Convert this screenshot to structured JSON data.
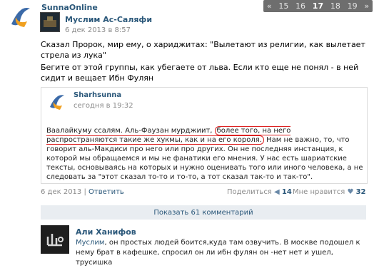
{
  "group": {
    "name": "SunnaOnline"
  },
  "pager": {
    "pages": [
      "«",
      "15",
      "16",
      "17",
      "18",
      "19",
      "»"
    ],
    "current": "17"
  },
  "post": {
    "author": "Муслим Ас-Саляфи",
    "date": "6 дек 2013 в 8:57",
    "paragraph1": "Сказал Пророк, мир ему, о хариджитах: \"Вылетают из религии, как вылетает стрела из лука\"",
    "paragraph2": "Бегите от этой группы, как убегаете от льва. Если кто еще не понял - в ней сидит и вещает Ибн Фулян"
  },
  "quote": {
    "author": "Sharhsunna",
    "date": "сегодня в 19:32",
    "text_before": "Ваалайкуму ссалям. Аль-Фаузан мурджиит, ",
    "text_highlight": "более того, на него распространяются такие же хукмы, как и на его короля.",
    "text_after": " Нам не важно, то, что говорит аль-Макдиси про него или про других. Он не последняя инстанция, к которой мы обращаемся и мы не фанатики его мнения. У нас есть шариатские тексты, основываясь на которых и нужно оценивать того или иного человека, а не следовать за \"этот сказал то-то и то-то, а тот сказал так-то и так-то\"."
  },
  "footer": {
    "date": "6 дек 2013",
    "separator": " | ",
    "reply": "Ответить",
    "share_label": "Поделиться",
    "share_count": "14",
    "like_label": "Мне нравится",
    "like_count": "32"
  },
  "comments_button": "Показать 61 комментарий",
  "comment": {
    "author": "Али Ханифов",
    "mention": "Муслим",
    "text": ", он простых людей боится,куда там озвучить. В москве подошел к нему брат в кафешке, спросил он ли ибн фулян он -нет нет и ушел, трусишка"
  }
}
